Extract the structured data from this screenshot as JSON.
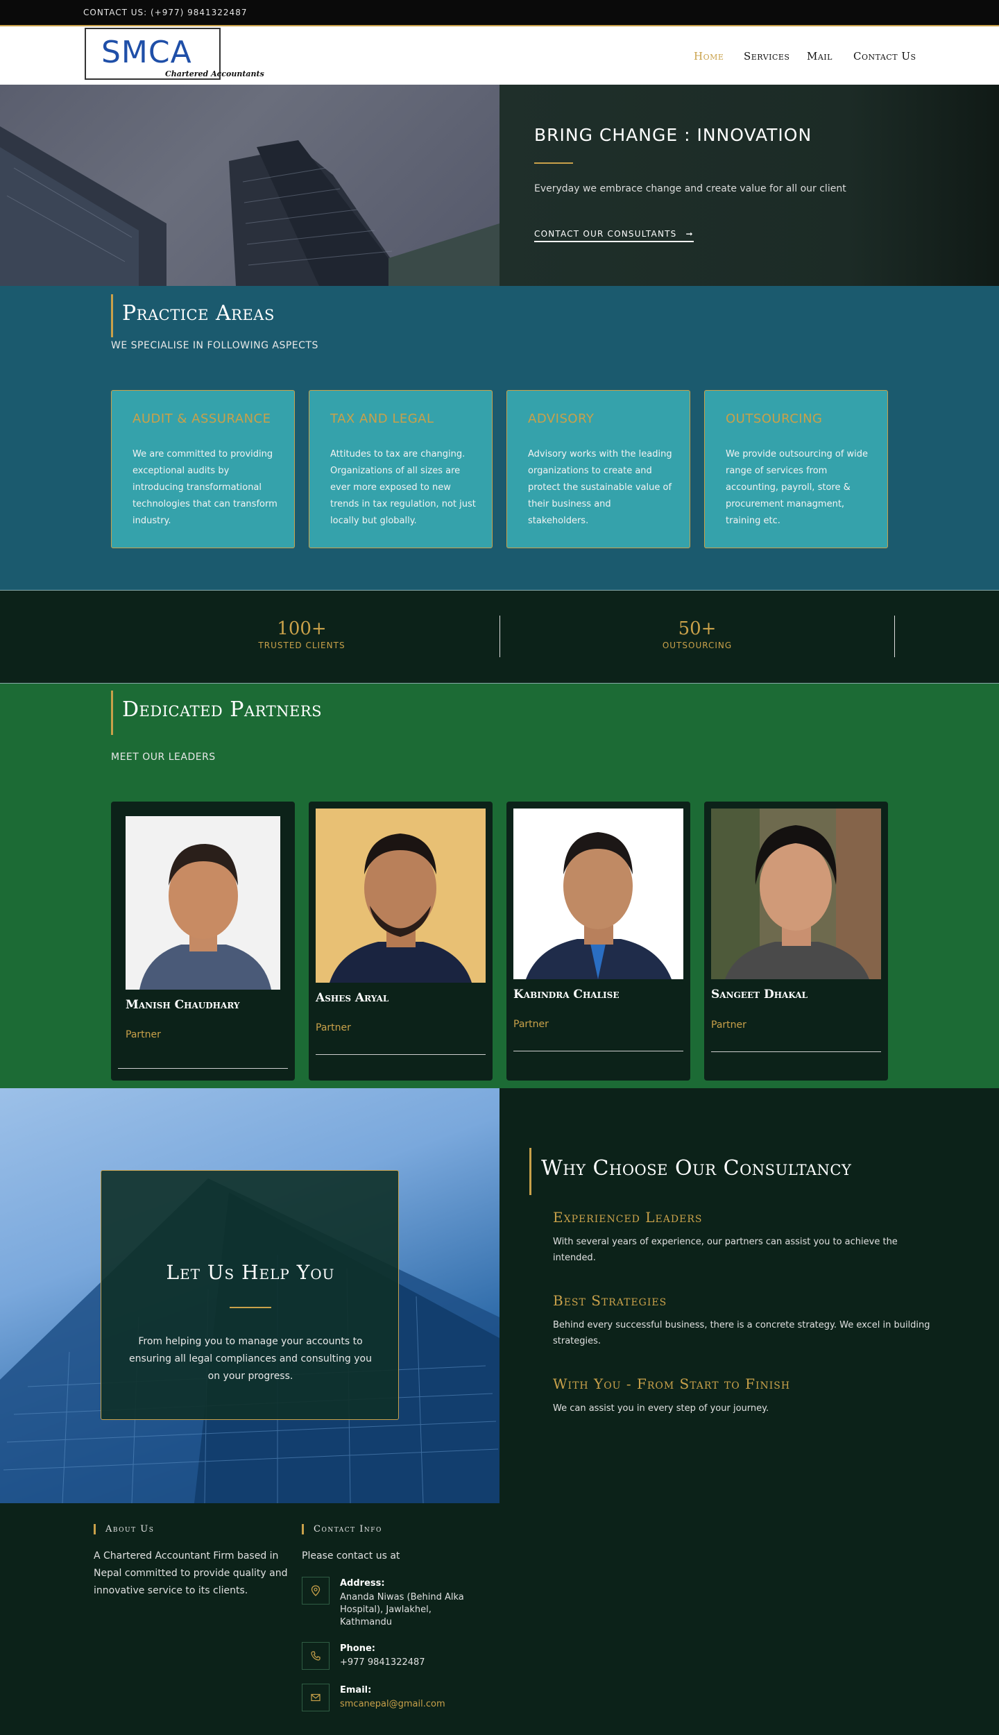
{
  "topbar": {
    "contact_text": "CONTACT US: (+977) 9841322487"
  },
  "navbar": {
    "logo_text": "SMCA",
    "logo_sub": "Chartered Accountants",
    "items": [
      "Home",
      "Services",
      "Mail",
      "Contact Us"
    ],
    "active_color": "#c9a14a"
  },
  "hero": {
    "title": "BRING CHANGE : INNOVATION",
    "subtitle": "Everyday we  embrace change and create value for all our client",
    "cta": "CONTACT OUR CONSULTANTS",
    "cta_icon": "arrow-right-icon"
  },
  "practice": {
    "title": "Practice Areas",
    "subtitle": "WE SPECIALISE IN FOLLOWING ASPECTS",
    "cards": [
      {
        "title": "AUDIT & ASSURANCE",
        "desc": "We are committed to providing exceptional audits by introducing transformational technologies that can transform industry."
      },
      {
        "title": "TAX AND LEGAL",
        "desc": "Attitudes to tax are changing. Organizations of all sizes are ever more exposed to new trends in tax regulation, not just locally but globally."
      },
      {
        "title": "ADVISORY",
        "desc": "Advisory works with the leading organizations to create and protect the sustainable value of their business and stakeholders."
      },
      {
        "title": "OUTSOURCING",
        "desc": "We provide outsourcing of wide range of services from accounting, payroll, store & procurement managment, training etc."
      }
    ]
  },
  "stats": [
    {
      "number": "100+",
      "label": "TRUSTED CLIENTS"
    },
    {
      "number": "50+",
      "label": "OUTSOURCING"
    }
  ],
  "partners": {
    "title": "Dedicated Partners",
    "subtitle": "MEET OUR LEADERS",
    "members": [
      {
        "name": "Manish Chaudhary",
        "role": "Partner"
      },
      {
        "name": "Ashes Aryal",
        "role": "Partner"
      },
      {
        "name": "Kabindra Chalise",
        "role": "Partner"
      },
      {
        "name": "Sangeet Dhakal",
        "role": "Partner"
      }
    ]
  },
  "help": {
    "title": "Let Us Help You",
    "text": "From helping you to manage your accounts to ensuring all legal compliances and consulting you on your progress."
  },
  "why": {
    "title": "Why Choose Our Consultancy",
    "items": [
      {
        "heading": "Experienced Leaders",
        "text": "With several years of experience, our partners can assist you to achieve the intended."
      },
      {
        "heading": "Best Strategies",
        "text": "Behind every successful business, there is a concrete strategy. We excel in building strategies."
      },
      {
        "heading": "With You - From Start to Finish",
        "text": "We can assist you in every step of your journey."
      }
    ]
  },
  "footer": {
    "about_heading": "About Us",
    "about_text": "A Chartered Accountant Firm based in Nepal committed to provide quality and innovative service to its clients.",
    "contact_heading": "Contact Info",
    "contact_intro": "Please contact us at",
    "address_label": "Address:",
    "address_value": "Ananda Niwas (Behind Alka Hospital), Jawlakhel, Kathmandu",
    "phone_label": "Phone:",
    "phone_value": "+977 9841322487",
    "email_label": "Email:",
    "email_value": "smcanepal@gmail.com"
  }
}
